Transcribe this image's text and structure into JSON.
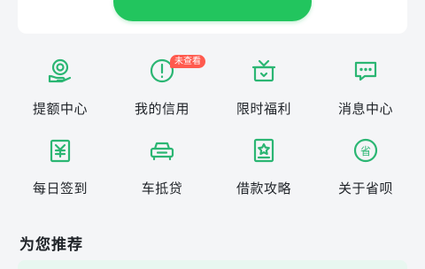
{
  "colors": {
    "accent": "#22c55e",
    "icon_green": "#2bb673",
    "badge_red": "#ff5a4e",
    "text_dark": "#1f2328",
    "background": "#f4f5f7"
  },
  "grid": {
    "items": [
      {
        "label": "提额中心",
        "icon": "limit-increase-icon"
      },
      {
        "label": "我的信用",
        "icon": "credit-alert-icon"
      },
      {
        "label": "限时福利",
        "icon": "gift-box-icon"
      },
      {
        "label": "消息中心",
        "icon": "message-icon"
      },
      {
        "label": "每日签到",
        "icon": "daily-checkin-icon"
      },
      {
        "label": "车抵贷",
        "icon": "car-loan-icon"
      },
      {
        "label": "借款攻略",
        "icon": "loan-guide-icon"
      },
      {
        "label": "关于省呗",
        "icon": "about-app-icon"
      }
    ],
    "badge": "未查看"
  },
  "section": {
    "title": "为您推荐"
  }
}
